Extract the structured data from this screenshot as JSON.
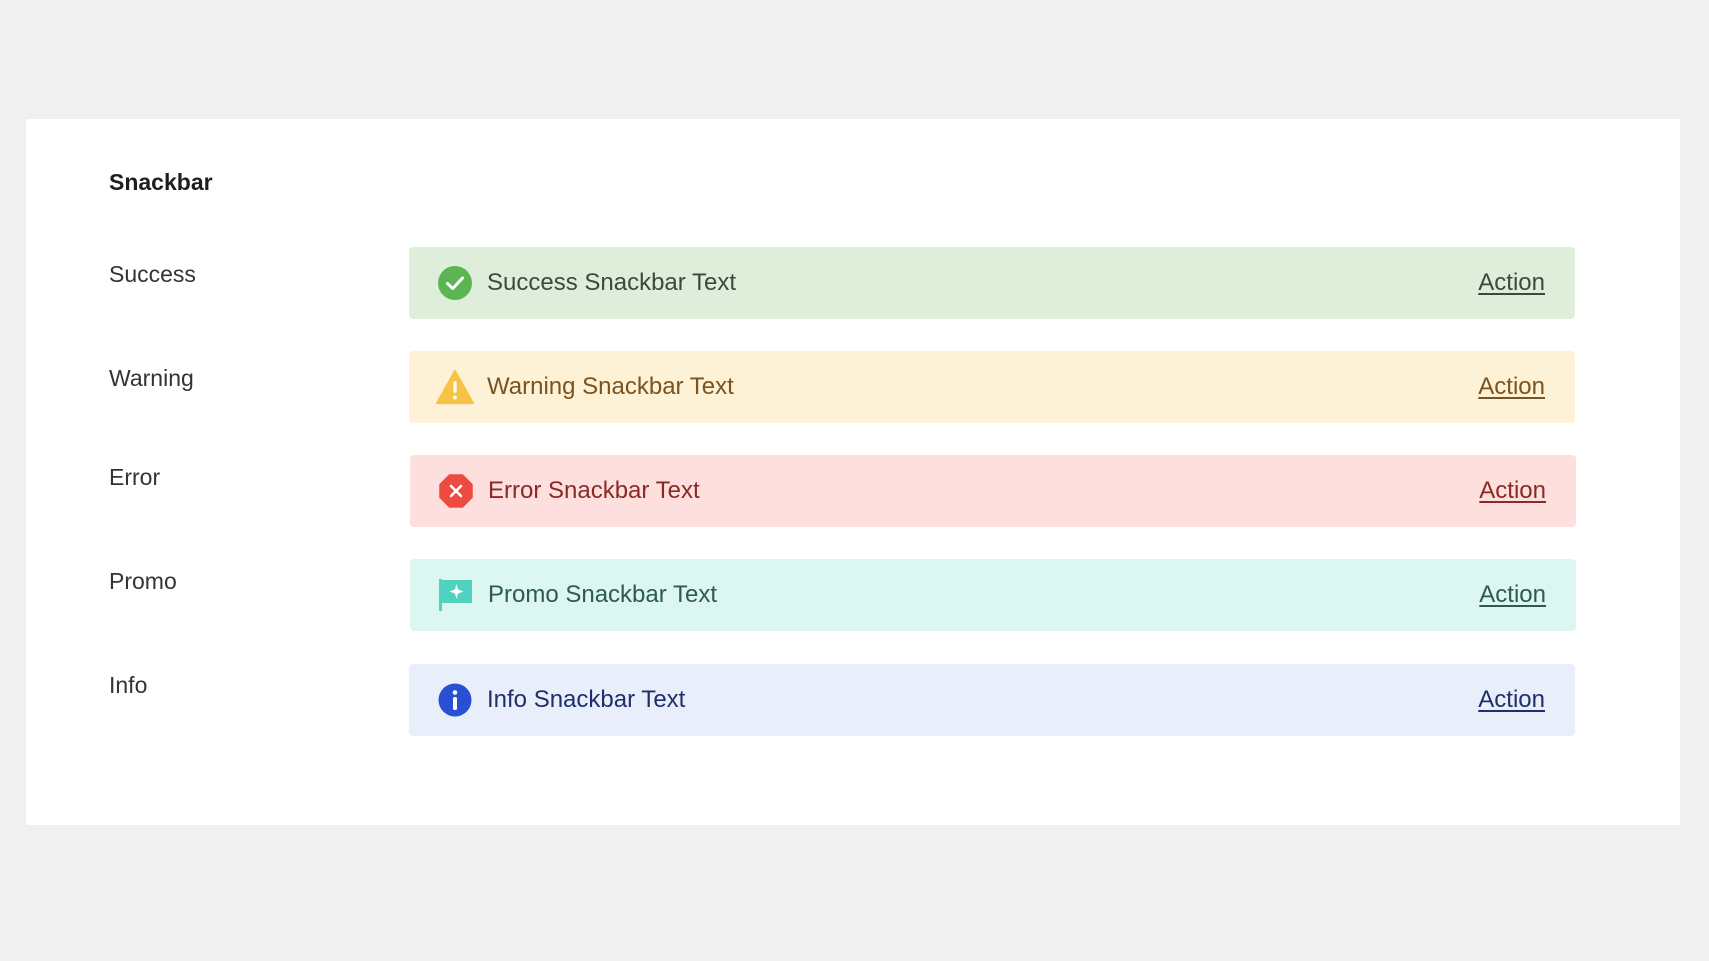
{
  "card": {
    "title": "Snackbar"
  },
  "rows": [
    {
      "id": "success",
      "label": "Success",
      "icon": "check-circle-icon",
      "text": "Success Snackbar Text",
      "action": "Action",
      "colors": {
        "background": "#deeedb",
        "icon": "#5ab552",
        "text": "#3c4a3a"
      }
    },
    {
      "id": "warning",
      "label": "Warning",
      "icon": "warning-triangle-icon",
      "text": "Warning Snackbar Text",
      "action": "Action",
      "colors": {
        "background": "#fdf1d6",
        "icon": "#f6c344",
        "text": "#7a5320"
      }
    },
    {
      "id": "error",
      "label": "Error",
      "icon": "error-octagon-icon",
      "text": "Error Snackbar Text",
      "action": "Action",
      "colors": {
        "background": "#fde0de",
        "icon": "#ee4b40",
        "text": "#8a2a24"
      }
    },
    {
      "id": "promo",
      "label": "Promo",
      "icon": "promo-flag-icon",
      "text": "Promo Snackbar Text",
      "action": "Action",
      "colors": {
        "background": "#dcf6f1",
        "icon": "#4fd3bf",
        "text": "#2f5953"
      }
    },
    {
      "id": "info",
      "label": "Info",
      "icon": "info-circle-icon",
      "text": "Info Snackbar Text",
      "action": "Action",
      "colors": {
        "background": "#e9eefb",
        "icon": "#2950d2",
        "text": "#1f2f6b"
      }
    }
  ]
}
